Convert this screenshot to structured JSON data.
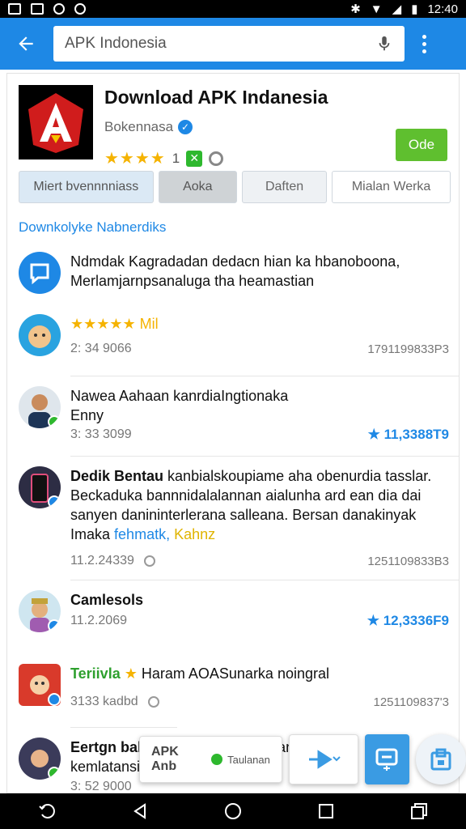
{
  "status_bar": {
    "time": "12:40"
  },
  "app_bar": {
    "search_value": "APK Indonesia",
    "icons": {
      "back": "arrow-left-icon",
      "mic": "mic-icon",
      "menu": "more-vert-icon"
    }
  },
  "app": {
    "title": "Download APK Indanesia",
    "developer": "Bokennasa",
    "rating_stars": "★★★★",
    "rating_value": "1",
    "install_label": "Ode",
    "colors": {
      "install": "#5fbf2f",
      "accent": "#1e88e5"
    }
  },
  "tabs": [
    "Miert bvennnniass",
    "Aoka",
    "Daften",
    "Mialan Werka"
  ],
  "section_title": "Downkolyke Nabnerdiks",
  "feed": [
    {
      "line1": "Ndmdak Kagradadan dedacn hian ka hbanoboona,",
      "line2": "Merlamjarnpsanaluga tha heamastian",
      "avatar": "chat-icon"
    },
    {
      "line1": "★★★★★ Mil",
      "date": "2: 34 9066",
      "right": "1791199833P3",
      "avatar": "dog-avatar"
    },
    {
      "line1": "Nawea Aahaan kanrdiaIngtionaka",
      "line2": "Enny",
      "date": "3: 33 3099",
      "right": "11,3388T9",
      "avatar": "man-avatar"
    },
    {
      "bold": "Dedik Bentau",
      "line1": "kanbialskoupiame aha obenurdia tasslar.",
      "line2": "Beckaduka bannnidalalannan aialunha ard ean dia dai",
      "line3": "sanyen danininterlerana salleana. Bersan danakinyak",
      "line4a": "Imaka",
      "line4b": "fehmatk,",
      "line4c": "Kahnz",
      "date": "11.2.24339",
      "right": "1251109833B3",
      "avatar": "phone-avatar"
    },
    {
      "bold": "Camlesols",
      "date": "11.2.2069",
      "right": "12,3336F9",
      "avatar": "king-avatar"
    },
    {
      "bold": "Teriivla",
      "line1": "Haram AOASunarka noingral",
      "date": "3133 kadbd",
      "right": "1251109837'3",
      "avatar": "cartoon-avatar"
    },
    {
      "bold": "Eertgn bahbala,",
      "line1": "hleduolangianlan",
      "line2": "kemlatansi",
      "date": "3: 52 9000",
      "avatar": "girl-avatar"
    }
  ],
  "fab": {
    "pill_label": "APK Anb",
    "pill_sub": "Taulanan"
  },
  "nav": {
    "back": "back-icon",
    "home": "home-icon",
    "recent": "recents-icon",
    "rotate": "rotate-icon",
    "switch": "switch-icon"
  }
}
